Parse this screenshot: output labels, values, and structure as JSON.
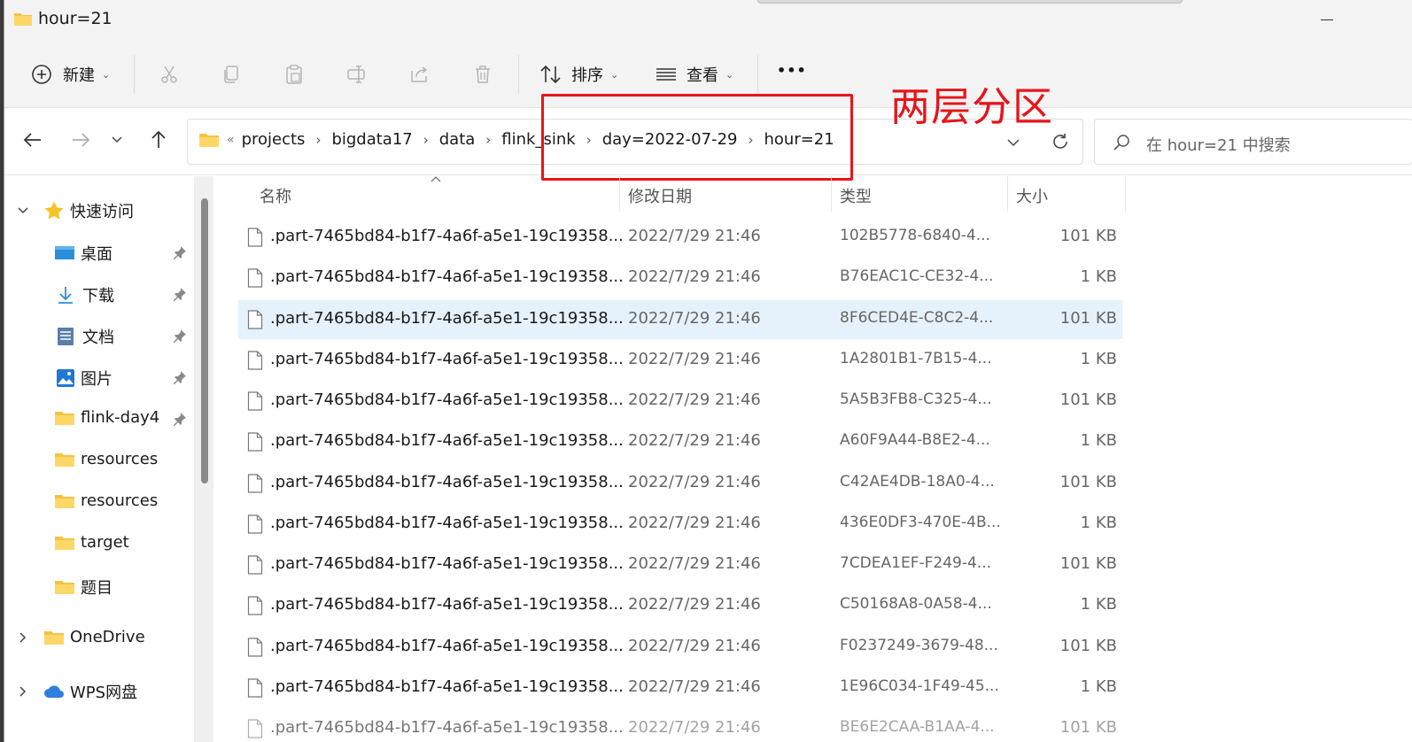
{
  "window": {
    "title": "hour=21"
  },
  "toolbar": {
    "new_label": "新建",
    "sort_label": "排序",
    "view_label": "查看",
    "more_label": "•••"
  },
  "address": {
    "overflow": "«",
    "crumbs": [
      "projects",
      "bigdata17",
      "data",
      "flink_sink",
      "day=2022-07-29",
      "hour=21"
    ]
  },
  "search": {
    "placeholder": "在 hour=21 中搜索"
  },
  "annotation": {
    "text": "两层分区",
    "color": "#e8141b"
  },
  "sidebar": {
    "quick_access": "快速访问",
    "items": [
      {
        "label": "桌面",
        "icon": "desktop-icon",
        "pinned": true
      },
      {
        "label": "下载",
        "icon": "download-icon",
        "pinned": true
      },
      {
        "label": "文档",
        "icon": "document-icon",
        "pinned": true
      },
      {
        "label": "图片",
        "icon": "pictures-icon",
        "pinned": true
      },
      {
        "label": "flink-day4",
        "icon": "folder-icon",
        "pinned": true
      },
      {
        "label": "resources",
        "icon": "folder-icon",
        "pinned": false
      },
      {
        "label": "resources",
        "icon": "folder-icon",
        "pinned": false
      },
      {
        "label": "target",
        "icon": "folder-icon",
        "pinned": false
      },
      {
        "label": "题目",
        "icon": "folder-icon",
        "pinned": false
      }
    ],
    "onedrive": "OneDrive",
    "wps": "WPS网盘"
  },
  "columns": {
    "name": "名称",
    "date": "修改日期",
    "type": "类型",
    "size": "大小"
  },
  "files": [
    {
      "name": ".part-7465bd84-b1f7-4a6f-a5e1-19c19358...",
      "date": "2022/7/29 21:46",
      "type": "102B5778-6840-4...",
      "size": "101 KB"
    },
    {
      "name": ".part-7465bd84-b1f7-4a6f-a5e1-19c19358...",
      "date": "2022/7/29 21:46",
      "type": "B76EAC1C-CE32-4...",
      "size": "1 KB"
    },
    {
      "name": ".part-7465bd84-b1f7-4a6f-a5e1-19c19358...",
      "date": "2022/7/29 21:46",
      "type": "8F6CED4E-C8C2-4...",
      "size": "101 KB"
    },
    {
      "name": ".part-7465bd84-b1f7-4a6f-a5e1-19c19358...",
      "date": "2022/7/29 21:46",
      "type": "1A2801B1-7B15-4...",
      "size": "1 KB"
    },
    {
      "name": ".part-7465bd84-b1f7-4a6f-a5e1-19c19358...",
      "date": "2022/7/29 21:46",
      "type": "5A5B3FB8-C325-4...",
      "size": "101 KB"
    },
    {
      "name": ".part-7465bd84-b1f7-4a6f-a5e1-19c19358...",
      "date": "2022/7/29 21:46",
      "type": "A60F9A44-B8E2-4...",
      "size": "1 KB"
    },
    {
      "name": ".part-7465bd84-b1f7-4a6f-a5e1-19c19358...",
      "date": "2022/7/29 21:46",
      "type": "C42AE4DB-18A0-4...",
      "size": "101 KB"
    },
    {
      "name": ".part-7465bd84-b1f7-4a6f-a5e1-19c19358...",
      "date": "2022/7/29 21:46",
      "type": "436E0DF3-470E-4B...",
      "size": "1 KB"
    },
    {
      "name": ".part-7465bd84-b1f7-4a6f-a5e1-19c19358...",
      "date": "2022/7/29 21:46",
      "type": "7CDEA1EF-F249-4...",
      "size": "101 KB"
    },
    {
      "name": ".part-7465bd84-b1f7-4a6f-a5e1-19c19358...",
      "date": "2022/7/29 21:46",
      "type": "C50168A8-0A58-4...",
      "size": "1 KB"
    },
    {
      "name": ".part-7465bd84-b1f7-4a6f-a5e1-19c19358...",
      "date": "2022/7/29 21:46",
      "type": "F0237249-3679-48...",
      "size": "101 KB"
    },
    {
      "name": ".part-7465bd84-b1f7-4a6f-a5e1-19c19358...",
      "date": "2022/7/29 21:46",
      "type": "1E96C034-1F49-45...",
      "size": "1 KB"
    },
    {
      "name": ".part-7465bd84-b1f7-4a6f-a5e1-19c19358...",
      "date": "2022/7/29 21:46",
      "type": "BE6E2CAA-B1AA-4...",
      "size": "101 KB"
    }
  ],
  "selected_row": 2
}
